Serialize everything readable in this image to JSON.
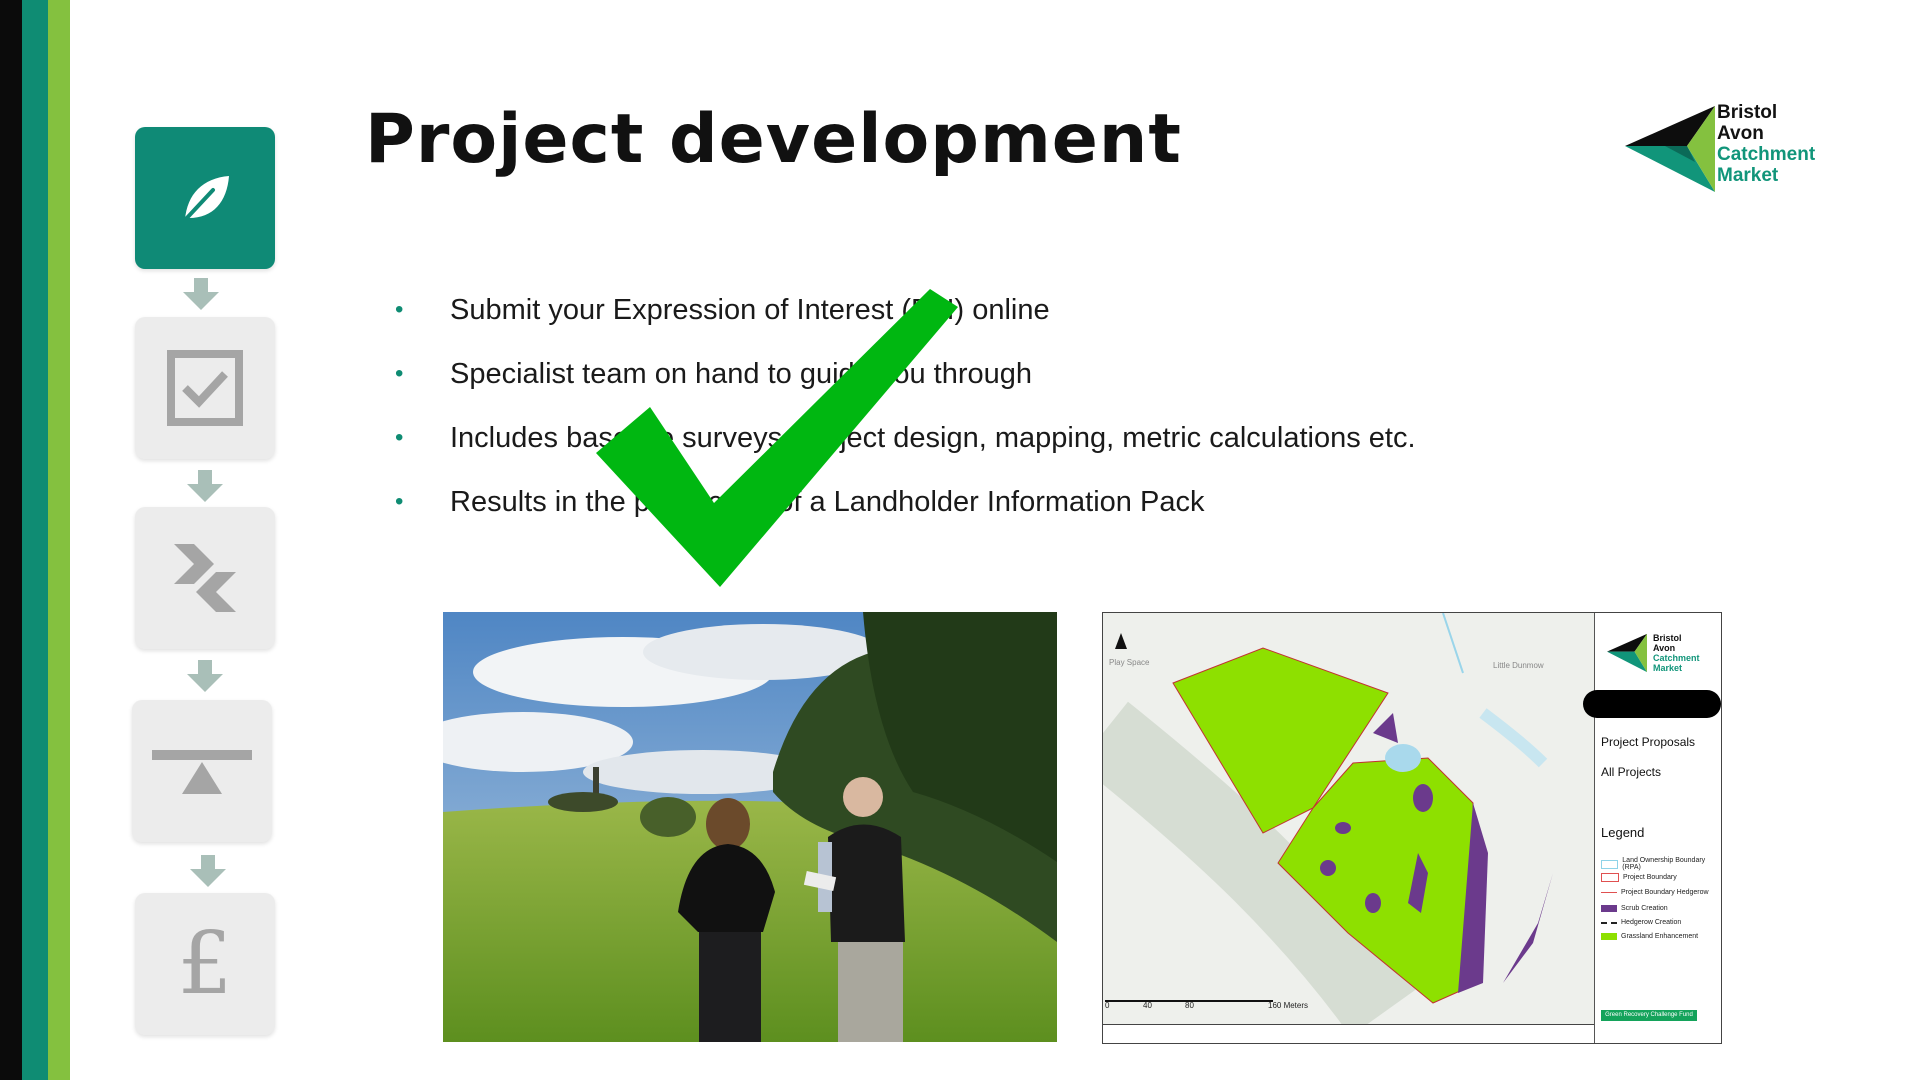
{
  "slide": {
    "title": "Project development",
    "brand_colors": {
      "teal": "#0f8c73",
      "lime": "#84c13f",
      "black": "#0b0b0b"
    }
  },
  "logo": {
    "line1": "Bristol",
    "line2": "Avon",
    "line3": "Catchment",
    "line4": "Market"
  },
  "steps": [
    {
      "icon": "leaf-icon",
      "active": true
    },
    {
      "icon": "checkbox-icon",
      "active": false
    },
    {
      "icon": "converge-arrows-icon",
      "active": false
    },
    {
      "icon": "balance-icon",
      "active": false
    },
    {
      "icon": "pound-icon",
      "active": false
    }
  ],
  "bullets": [
    "Submit your Expression of Interest (EoI) online",
    "Specialist team on hand to guide you through",
    "Includes baseline surveys, project design, mapping, metric calculations etc.",
    "Results in the production of a Landholder Information Pack"
  ],
  "map": {
    "logo_line1": "Bristol",
    "logo_line2": "Avon",
    "logo_line3": "Catchment",
    "logo_line4": "Market",
    "label_proposals": "Project Proposals",
    "label_all": "All Projects",
    "legend_title": "Legend",
    "legend": [
      {
        "label": "Land Ownership Boundary (RPA)",
        "color": "#8fd3e8"
      },
      {
        "label": "Project Boundary",
        "color": "#e05050"
      },
      {
        "label": "Project Boundary Hedgerow",
        "color": "#e05050"
      },
      {
        "label": "Scrub Creation",
        "color": "#6b3a8c"
      },
      {
        "label": "Hedgerow Creation",
        "color": "#222222"
      },
      {
        "label": "Grassland Enhancement",
        "color": "#8ee000"
      }
    ],
    "scale_0": "0",
    "scale_40": "40",
    "scale_80": "80",
    "scale_160": "160 Meters",
    "place_play": "Play Space",
    "place_dunmow": "Little Dunmow",
    "fund": "Green Recovery Challenge Fund"
  }
}
